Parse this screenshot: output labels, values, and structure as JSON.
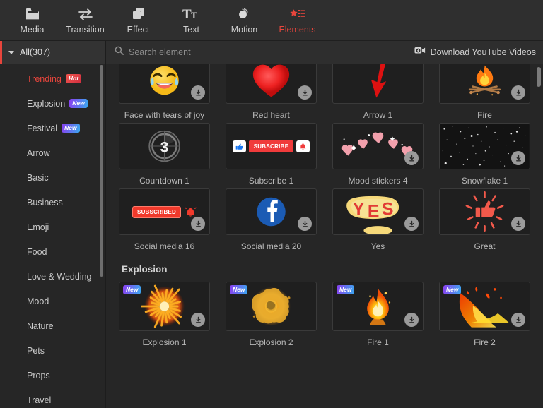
{
  "toolbar": {
    "tabs": [
      {
        "label": "Media",
        "icon": "media-folder-icon",
        "active": false
      },
      {
        "label": "Transition",
        "icon": "transition-arrows-icon",
        "active": false
      },
      {
        "label": "Effect",
        "icon": "effect-squares-icon",
        "active": false
      },
      {
        "label": "Text",
        "icon": "text-tt-icon",
        "active": false
      },
      {
        "label": "Motion",
        "icon": "motion-ball-icon",
        "active": false
      },
      {
        "label": "Elements",
        "icon": "elements-star-list-icon",
        "active": true
      }
    ],
    "active_color": "#e8453c"
  },
  "sidebar": {
    "header": {
      "label": "All(307)",
      "expanded": true
    },
    "items": [
      {
        "label": "Trending",
        "badge": "Hot",
        "badge_type": "hot",
        "selected": true
      },
      {
        "label": "Explosion",
        "badge": "New",
        "badge_type": "new",
        "selected": false
      },
      {
        "label": "Festival",
        "badge": "New",
        "badge_type": "new",
        "selected": false
      },
      {
        "label": "Arrow",
        "badge": null,
        "selected": false
      },
      {
        "label": "Basic",
        "badge": null,
        "selected": false
      },
      {
        "label": "Business",
        "badge": null,
        "selected": false
      },
      {
        "label": "Emoji",
        "badge": null,
        "selected": false
      },
      {
        "label": "Food",
        "badge": null,
        "selected": false
      },
      {
        "label": "Love & Wedding",
        "badge": null,
        "selected": false
      },
      {
        "label": "Mood",
        "badge": null,
        "selected": false
      },
      {
        "label": "Nature",
        "badge": null,
        "selected": false
      },
      {
        "label": "Pets",
        "badge": null,
        "selected": false
      },
      {
        "label": "Props",
        "badge": null,
        "selected": false
      },
      {
        "label": "Travel",
        "badge": null,
        "selected": false
      }
    ]
  },
  "search": {
    "placeholder": "Search element",
    "value": "",
    "icon": "search-icon"
  },
  "download_youtube": {
    "label": "Download YouTube Videos",
    "icon": "video-download-icon"
  },
  "sections": [
    {
      "title": "",
      "items": [
        {
          "name": "Face with tears of joy",
          "art": "joy",
          "download": true,
          "new": false
        },
        {
          "name": "Red heart",
          "art": "heart",
          "download": true,
          "new": false
        },
        {
          "name": "Arrow 1",
          "art": "arrow",
          "download": false,
          "new": false
        },
        {
          "name": "Fire",
          "art": "campfire",
          "download": true,
          "new": false
        },
        {
          "name": "Countdown 1",
          "art": "countdown",
          "download": false,
          "new": false
        },
        {
          "name": "Subscribe 1",
          "art": "subscribe",
          "download": false,
          "new": false
        },
        {
          "name": "Mood stickers 4",
          "art": "hearts",
          "download": true,
          "new": false
        },
        {
          "name": "Snowflake 1",
          "art": "snow",
          "download": true,
          "new": false
        },
        {
          "name": "Social media 16",
          "art": "subscribed",
          "download": true,
          "new": false
        },
        {
          "name": "Social media 20",
          "art": "facebook",
          "download": true,
          "new": false
        },
        {
          "name": "Yes",
          "art": "yes",
          "download": true,
          "new": false
        },
        {
          "name": "Great",
          "art": "thumbup",
          "download": true,
          "new": false
        }
      ]
    },
    {
      "title": "Explosion",
      "items": [
        {
          "name": "Explosion 1",
          "art": "explosion1",
          "download": true,
          "new": true
        },
        {
          "name": "Explosion 2",
          "art": "explosion2",
          "download": false,
          "new": true
        },
        {
          "name": "Fire 1",
          "art": "fire1",
          "download": true,
          "new": true
        },
        {
          "name": "Fire 2",
          "art": "fire2",
          "download": true,
          "new": true
        }
      ]
    }
  ],
  "countdown_number": "3",
  "subscribe_label": "SUBSCRIBE",
  "subscribed_label": "SUBSCRIBED",
  "yes_label": "YES",
  "colors": {
    "accent": "#e8453c",
    "panel_bg": "#262626",
    "toolbar_bg": "#2f2f2f",
    "thumb_bg": "#1f1f1f"
  }
}
